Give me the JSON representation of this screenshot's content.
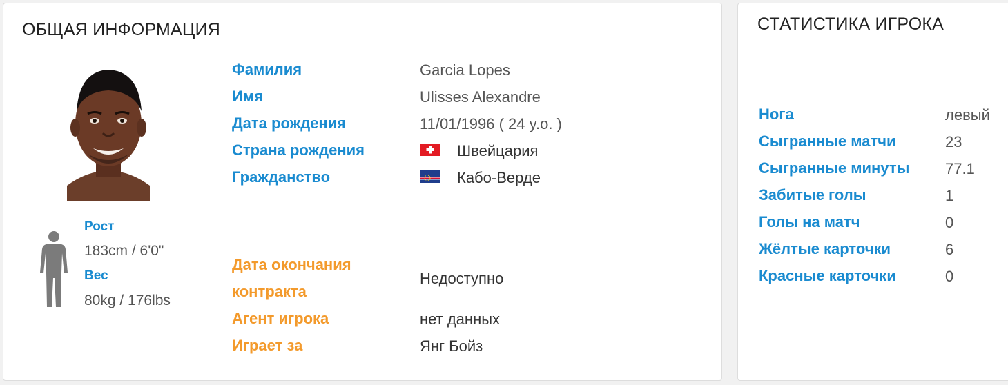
{
  "general": {
    "title": "ОБЩАЯ ИНФОРМАЦИЯ",
    "fields": {
      "surname": {
        "label": "Фамилия",
        "value": "Garcia Lopes"
      },
      "name": {
        "label": "Имя",
        "value": "Ulisses Alexandre"
      },
      "birth_date": {
        "label": "Дата рождения",
        "value": "11/01/1996 ( 24 y.o. )"
      },
      "birth_country": {
        "label": "Страна рождения",
        "value": "Швейцария",
        "flag": "flag-switzerland"
      },
      "citizenship": {
        "label": "Гражданство",
        "value": "Кабо-Верде",
        "flag": "flag-cape-verde"
      }
    },
    "physical": {
      "height_label": "Рост",
      "height_value": "183cm / 6'0\"",
      "weight_label": "Вес",
      "weight_value": "80kg / 176lbs"
    },
    "contract": {
      "end_label_line1": "Дата окончания",
      "end_label_line2": "контракта",
      "end_value": "Недоступно",
      "agent_label": "Агент игрока",
      "agent_value": "нет данных",
      "club_label": "Играет за",
      "club_value": "Янг Бойз"
    }
  },
  "stats": {
    "title": "СТАТИСТИКА ИГРОКА",
    "rows": [
      {
        "label": "Нога",
        "value": "левый"
      },
      {
        "label": "Сыгранные матчи",
        "value": "23"
      },
      {
        "label": "Сыгранные минуты",
        "value": "77.1"
      },
      {
        "label": "Забитые голы",
        "value": "1"
      },
      {
        "label": "Голы на матч",
        "value": "0"
      },
      {
        "label": "Жёлтые карточки",
        "value": "6"
      },
      {
        "label": "Красные карточки",
        "value": "0"
      }
    ]
  },
  "colors": {
    "label_blue": "#1a8bd0",
    "label_orange": "#f39a2c",
    "value_gray": "#555555",
    "card_border": "#dddddd"
  }
}
